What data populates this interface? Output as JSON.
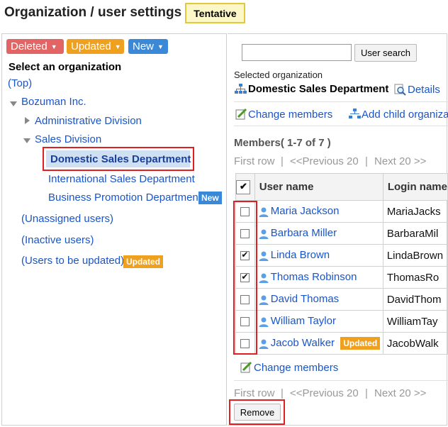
{
  "header": {
    "title": "Organization / user settings",
    "tentative_label": "Tentative"
  },
  "left": {
    "filters": [
      {
        "label": "Deleted",
        "color": "#e26464"
      },
      {
        "label": "Updated",
        "color": "#f0a01f"
      },
      {
        "label": "New",
        "color": "#3a88d8"
      }
    ],
    "heading": "Select an organization",
    "top_link": "(Top)",
    "tree": {
      "root": "Bozuman Inc.",
      "admin_division": "Administrative Division",
      "sales_division": "Sales Division",
      "selected_department": "Domestic Sales Department",
      "international": "International Sales Department",
      "business_promotion": "Business Promotion Department",
      "new_tag": "New"
    },
    "unassigned": "(Unassigned users)",
    "inactive": "(Inactive users)",
    "to_be_updated": "(Users to be updated)",
    "updated_tag": "Updated"
  },
  "right": {
    "search_placeholder": "",
    "search_button": "User search",
    "selected_org_label": "Selected organization",
    "department_name": "Domestic Sales Department",
    "details_link": "Details",
    "change_members": "Change members",
    "add_child": "Add child organiza",
    "members_count": "Members( 1-7 of 7 )",
    "pager": {
      "first": "First row",
      "prev": "<<Previous 20",
      "next": "Next 20 >>"
    },
    "columns": {
      "user_name": "User name",
      "login_name": "Login name"
    },
    "rows": [
      {
        "name": "Maria Jackson",
        "login": "MariaJacks",
        "checked": false,
        "updated": false
      },
      {
        "name": "Barbara Miller",
        "login": "BarbaraMil",
        "checked": false,
        "updated": false
      },
      {
        "name": "Linda Brown",
        "login": "LindaBrown",
        "checked": true,
        "updated": false
      },
      {
        "name": "Thomas Robinson",
        "login": "ThomasRo",
        "checked": true,
        "updated": false
      },
      {
        "name": "David Thomas",
        "login": "DavidThom",
        "checked": false,
        "updated": false
      },
      {
        "name": "William Taylor",
        "login": "WilliamTay",
        "checked": false,
        "updated": false
      },
      {
        "name": "Jacob Walker",
        "login": "JacobWalk",
        "checked": false,
        "updated": true
      }
    ],
    "updated_tag": "Updated",
    "change_members_bottom": "Change members",
    "remove_button": "Remove"
  }
}
